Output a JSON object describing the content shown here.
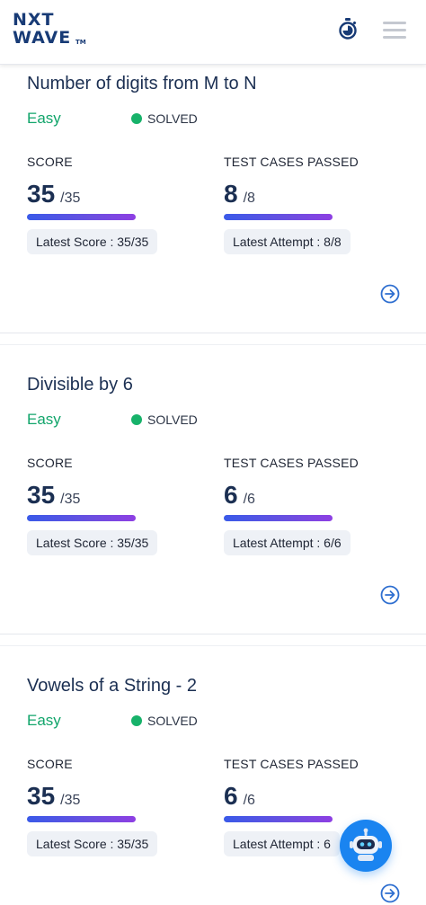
{
  "header": {
    "logo_line1": "NXT",
    "logo_line2": "WAVE",
    "logo_tm": "TM",
    "timer_icon": "stopwatch-icon",
    "menu_icon": "hamburger-menu-icon"
  },
  "problems": [
    {
      "title": "Number of digits from M to N",
      "difficulty": "Easy",
      "status": "SOLVED",
      "score_label": "SCORE",
      "score": "35",
      "score_total": "/35",
      "latest_score": "Latest Score : 35/35",
      "tests_label": "TEST CASES PASSED",
      "tests": "8",
      "tests_total": "/8",
      "latest_attempt": "Latest Attempt : 8/8"
    },
    {
      "title": "Divisible by 6",
      "difficulty": "Easy",
      "status": "SOLVED",
      "score_label": "SCORE",
      "score": "35",
      "score_total": "/35",
      "latest_score": "Latest Score : 35/35",
      "tests_label": "TEST CASES PASSED",
      "tests": "6",
      "tests_total": "/6",
      "latest_attempt": "Latest Attempt : 6/6"
    },
    {
      "title": "Vowels of a String - 2",
      "difficulty": "Easy",
      "status": "SOLVED",
      "score_label": "SCORE",
      "score": "35",
      "score_total": "/35",
      "latest_score": "Latest Score : 35/35",
      "tests_label": "TEST CASES PASSED",
      "tests": "6",
      "tests_total": "/6",
      "latest_attempt": "Latest Attempt : 6"
    }
  ],
  "colors": {
    "brand": "#183b76",
    "easy": "#12a56b",
    "solved_dot": "#17b26a",
    "accent_button": "#1a84f0"
  },
  "chat_bot_icon": "robot-icon"
}
